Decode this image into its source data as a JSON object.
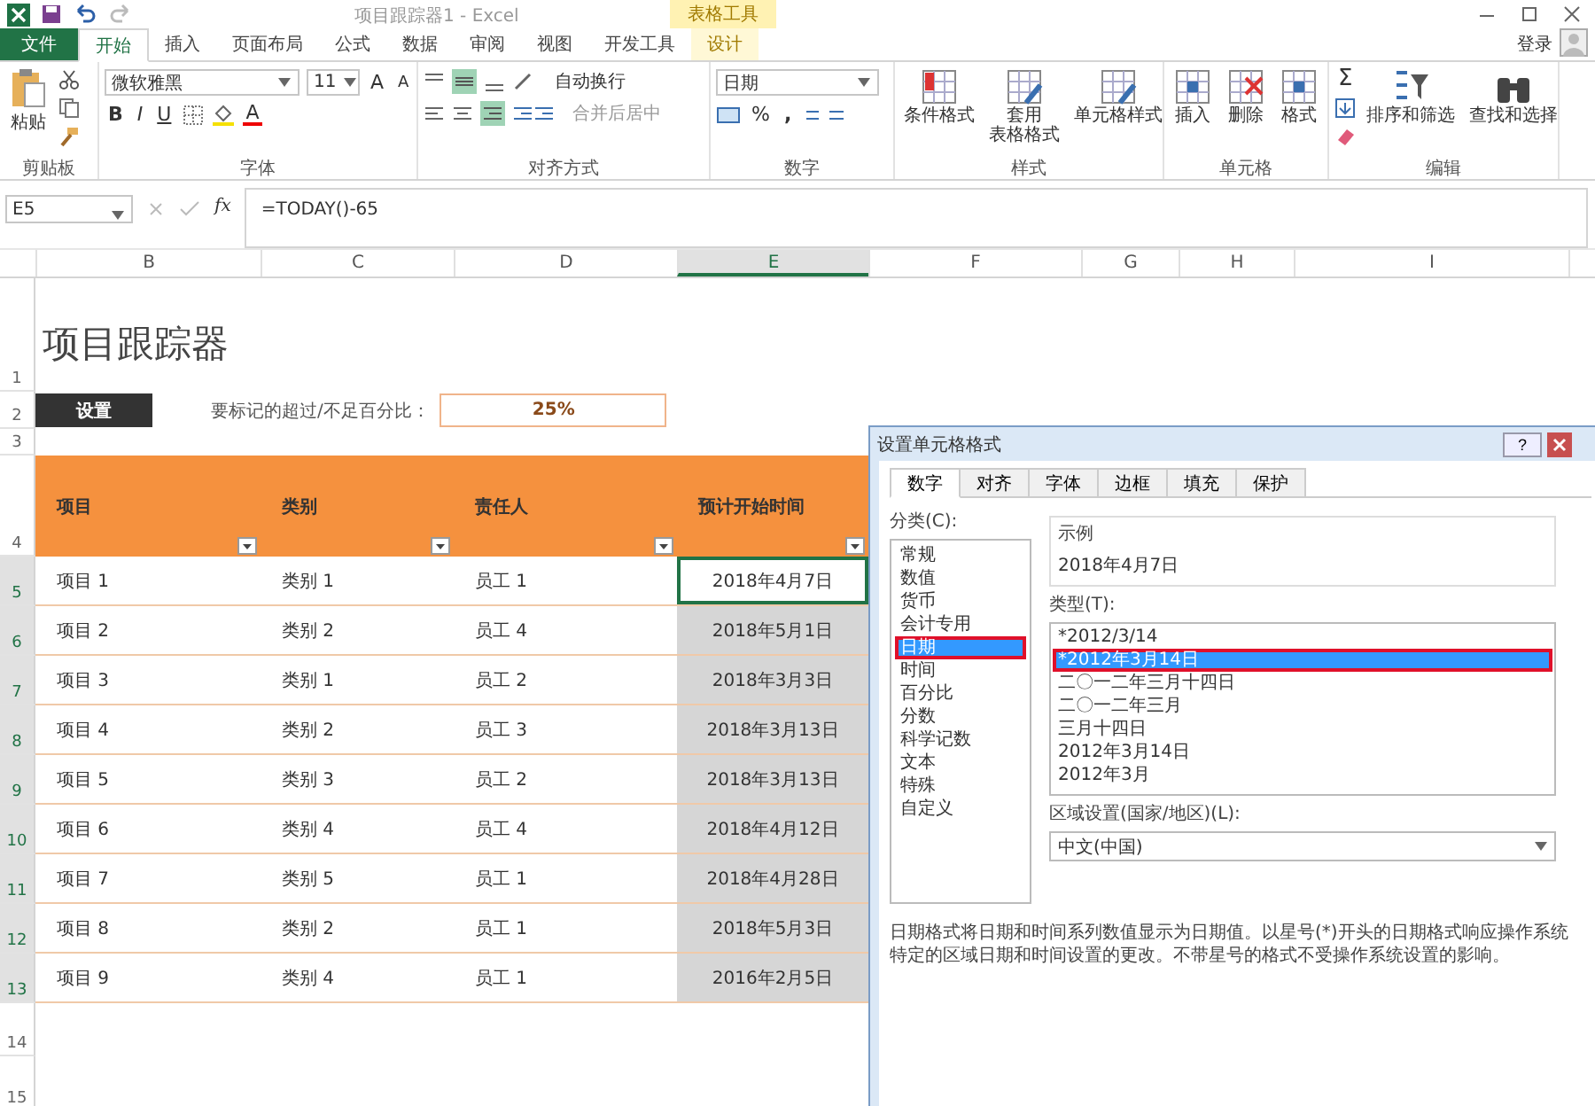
{
  "window": {
    "title": "项目跟踪器1 - Excel",
    "context_tab": "表格工具",
    "sign_in": "登录"
  },
  "ribbon_tabs": [
    {
      "label": "文件",
      "kind": "file",
      "selected": false
    },
    {
      "label": "开始",
      "kind": "tab",
      "selected": true
    },
    {
      "label": "插入",
      "kind": "tab",
      "selected": false
    },
    {
      "label": "页面布局",
      "kind": "tab",
      "selected": false
    },
    {
      "label": "公式",
      "kind": "tab",
      "selected": false
    },
    {
      "label": "数据",
      "kind": "tab",
      "selected": false
    },
    {
      "label": "审阅",
      "kind": "tab",
      "selected": false
    },
    {
      "label": "视图",
      "kind": "tab",
      "selected": false
    },
    {
      "label": "开发工具",
      "kind": "tab",
      "selected": false
    },
    {
      "label": "设计",
      "kind": "context",
      "selected": false
    }
  ],
  "ribbon": {
    "clipboard": {
      "label": "剪贴板",
      "paste": "粘贴"
    },
    "font": {
      "label": "字体",
      "font_name": "微软雅黑",
      "font_size": "11",
      "grow": "A",
      "shrink": "A",
      "bold": "B",
      "italic": "I",
      "underline": "U",
      "font_color": "A"
    },
    "alignment": {
      "label": "对齐方式",
      "wrap_text": "自动换行",
      "merge_center": "合并后居中"
    },
    "number": {
      "label": "数字",
      "format": "日期",
      "percent": "%",
      "comma": ","
    },
    "styles": {
      "label": "样式",
      "buttons": [
        {
          "lines": [
            "条件格式"
          ],
          "kind": "conditional"
        },
        {
          "lines": [
            "套用",
            "表格格式"
          ],
          "kind": "table"
        },
        {
          "lines": [
            "单元格样式"
          ],
          "kind": "cellstyle"
        }
      ]
    },
    "cells": {
      "label": "单元格",
      "buttons": [
        {
          "lines": [
            "插入"
          ],
          "kind": "insert"
        },
        {
          "lines": [
            "删除"
          ],
          "kind": "delete"
        },
        {
          "lines": [
            "格式"
          ],
          "kind": "format"
        }
      ]
    },
    "editing": {
      "label": "编辑",
      "sum": "Σ",
      "buttons": [
        {
          "label": "排序和筛选",
          "kind": "sort"
        },
        {
          "label": "查找和选择",
          "kind": "find"
        }
      ]
    }
  },
  "formula_bar": {
    "name_box": "E5",
    "fx": "fx",
    "formula": "=TODAY()-65"
  },
  "columns": [
    {
      "label": "B",
      "selected": false
    },
    {
      "label": "C",
      "selected": false
    },
    {
      "label": "D",
      "selected": false
    },
    {
      "label": "E",
      "selected": true
    },
    {
      "label": "F",
      "selected": false
    },
    {
      "label": "G",
      "selected": false
    },
    {
      "label": "H",
      "selected": false
    },
    {
      "label": "I",
      "selected": false
    }
  ],
  "row_numbers": [
    {
      "label": "1",
      "selected": false
    },
    {
      "label": "2",
      "selected": false
    },
    {
      "label": "3",
      "selected": false
    },
    {
      "label": "4",
      "selected": false
    },
    {
      "label": "5",
      "selected": true
    },
    {
      "label": "6",
      "selected": true
    },
    {
      "label": "7",
      "selected": true
    },
    {
      "label": "8",
      "selected": true
    },
    {
      "label": "9",
      "selected": true
    },
    {
      "label": "10",
      "selected": true
    },
    {
      "label": "11",
      "selected": true
    },
    {
      "label": "12",
      "selected": true
    },
    {
      "label": "13",
      "selected": true
    },
    {
      "label": "14",
      "selected": false
    },
    {
      "label": "15",
      "selected": false
    }
  ],
  "sheet": {
    "title": "项目跟踪器",
    "settings_button": "设置",
    "threshold_label": "要标记的超过/不足百分比：",
    "threshold_value": "25%",
    "headers": [
      "项目",
      "类别",
      "责任人",
      "预计开始时间"
    ],
    "rows": [
      {
        "item": "项目 1",
        "category": "类别 1",
        "owner": "员工 1",
        "start": "2018年4月7日",
        "active": true
      },
      {
        "item": "项目 2",
        "category": "类别 2",
        "owner": "员工 4",
        "start": "2018年5月1日",
        "active": false
      },
      {
        "item": "项目 3",
        "category": "类别 1",
        "owner": "员工 2",
        "start": "2018年3月3日",
        "active": false
      },
      {
        "item": "项目 4",
        "category": "类别 2",
        "owner": "员工 3",
        "start": "2018年3月13日",
        "active": false
      },
      {
        "item": "项目 5",
        "category": "类别 3",
        "owner": "员工 2",
        "start": "2018年3月13日",
        "active": false
      },
      {
        "item": "项目 6",
        "category": "类别 4",
        "owner": "员工 4",
        "start": "2018年4月12日",
        "active": false
      },
      {
        "item": "项目 7",
        "category": "类别 5",
        "owner": "员工 1",
        "start": "2018年4月28日",
        "active": false
      },
      {
        "item": "项目 8",
        "category": "类别 2",
        "owner": "员工 1",
        "start": "2018年5月3日",
        "active": false
      },
      {
        "item": "项目 9",
        "category": "类别 4",
        "owner": "员工 1",
        "start": "2016年2月5日",
        "active": false
      }
    ]
  },
  "dialog": {
    "title": "设置单元格格式",
    "help": "?",
    "tabs": [
      {
        "label": "数字",
        "selected": true
      },
      {
        "label": "对齐",
        "selected": false
      },
      {
        "label": "字体",
        "selected": false
      },
      {
        "label": "边框",
        "selected": false
      },
      {
        "label": "填充",
        "selected": false
      },
      {
        "label": "保护",
        "selected": false
      }
    ],
    "category_label": "分类(C):",
    "categories": [
      {
        "label": "常规",
        "selected": false,
        "highlighted": false
      },
      {
        "label": "数值",
        "selected": false,
        "highlighted": false
      },
      {
        "label": "货币",
        "selected": false,
        "highlighted": false
      },
      {
        "label": "会计专用",
        "selected": false,
        "highlighted": false
      },
      {
        "label": "日期",
        "selected": true,
        "highlighted": true
      },
      {
        "label": "时间",
        "selected": false,
        "highlighted": false
      },
      {
        "label": "百分比",
        "selected": false,
        "highlighted": false
      },
      {
        "label": "分数",
        "selected": false,
        "highlighted": false
      },
      {
        "label": "科学记数",
        "selected": false,
        "highlighted": false
      },
      {
        "label": "文本",
        "selected": false,
        "highlighted": false
      },
      {
        "label": "特殊",
        "selected": false,
        "highlighted": false
      },
      {
        "label": "自定义",
        "selected": false,
        "highlighted": false
      }
    ],
    "sample_label": "示例",
    "sample": "2018年4月7日",
    "type_label": "类型(T):",
    "types": [
      {
        "label": "*2012/3/14",
        "selected": false,
        "highlighted": false
      },
      {
        "label": "*2012年3月14日",
        "selected": true,
        "highlighted": true
      },
      {
        "label": "二〇一二年三月十四日",
        "selected": false,
        "highlighted": false
      },
      {
        "label": "二〇一二年三月",
        "selected": false,
        "highlighted": false
      },
      {
        "label": "三月十四日",
        "selected": false,
        "highlighted": false
      },
      {
        "label": "2012年3月14日",
        "selected": false,
        "highlighted": false
      },
      {
        "label": "2012年3月",
        "selected": false,
        "highlighted": false
      }
    ],
    "locale_label": "区域设置(国家/地区)(L):",
    "locale": "中文(中国)",
    "description": "日期格式将日期和时间系列数值显示为日期值。以星号(*)开头的日期格式响应操作系统特定的区域日期和时间设置的更改。不带星号的格式不受操作系统设置的影响。"
  }
}
